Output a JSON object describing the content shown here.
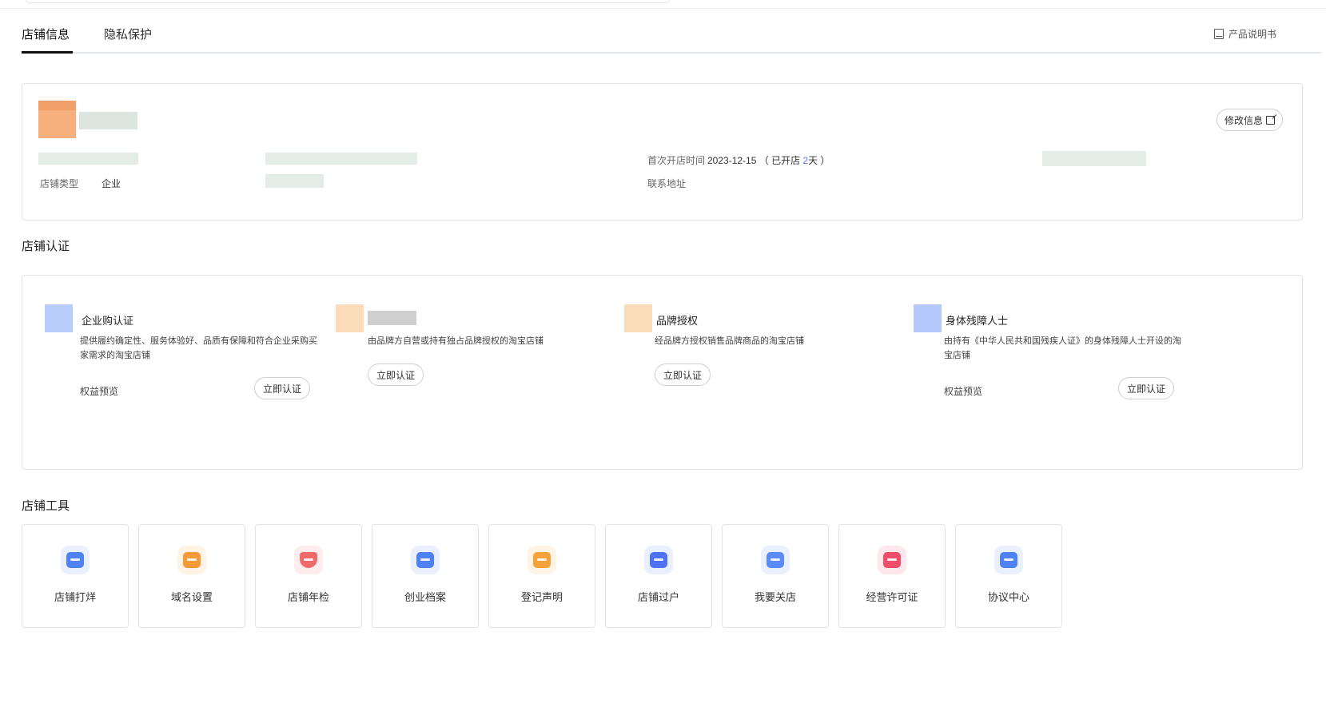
{
  "tabs": [
    {
      "label": "店铺信息",
      "active": true
    },
    {
      "label": "隐私保护",
      "active": false
    }
  ],
  "manual_link": "产品说明书",
  "shop_info": {
    "edit_label": "修改信息",
    "shop_type_label": "店铺类型",
    "shop_type_value": "企业",
    "open_time_label": "首次开店时间",
    "open_date": "2023-12-15",
    "open_prefix": "（ 已开店 ",
    "open_days": "2",
    "open_suffix": "天 ）",
    "address_label": "联系地址",
    "avatar_color": "#f6b07d"
  },
  "cert_section": {
    "title": "店铺认证",
    "items": [
      {
        "name": "企业购认证",
        "desc": "提供履约确定性、服务体验好、品质有保障和符合企业采购买家需求的淘宝店铺",
        "benefit": "权益预览",
        "button": "立即认证",
        "icon_color": "#b9cdfb"
      },
      {
        "name": "",
        "desc": "由品牌方自营或持有独占品牌授权的淘宝店铺",
        "benefit": "",
        "button": "立即认证",
        "icon_color": "#fbdcb8"
      },
      {
        "name": "品牌授权",
        "desc": "经品牌方授权销售品牌商品的淘宝店铺",
        "benefit": "",
        "button": "立即认证",
        "icon_color": "#fbdcb8"
      },
      {
        "name": "身体残障人士",
        "desc": "由持有《中华人民共和国残疾人证》的身体残障人士开设的淘宝店铺",
        "benefit": "权益预览",
        "button": "立即认证",
        "icon_color": "#b4c8fb"
      }
    ]
  },
  "tools_section": {
    "title": "店铺工具",
    "items": [
      {
        "label": "店铺打烊",
        "icon": "store-close-icon",
        "color": "#4f82f5",
        "bg": "#eaf0ff"
      },
      {
        "label": "域名设置",
        "icon": "domain-icon",
        "color": "#f59a3a",
        "bg": "#fff3e6"
      },
      {
        "label": "店铺年检",
        "icon": "inspection-shield-icon",
        "color": "#f06a6a",
        "bg": "#ffecec"
      },
      {
        "label": "创业档案",
        "icon": "archive-icon",
        "color": "#4f82f5",
        "bg": "#eaf0ff"
      },
      {
        "label": "登记声明",
        "icon": "register-icon",
        "color": "#f5a23a",
        "bg": "#fff3e6"
      },
      {
        "label": "店铺过户",
        "icon": "transfer-icon",
        "color": "#4f72f5",
        "bg": "#eaf0ff"
      },
      {
        "label": "我要关店",
        "icon": "close-shop-icon",
        "color": "#5b8bf7",
        "bg": "#eaf0ff"
      },
      {
        "label": "经营许可证",
        "icon": "license-icon",
        "color": "#ef4f6b",
        "bg": "#ffe8ec"
      },
      {
        "label": "协议中心",
        "icon": "agreement-icon",
        "color": "#4f82f5",
        "bg": "#eaf0ff"
      }
    ]
  }
}
